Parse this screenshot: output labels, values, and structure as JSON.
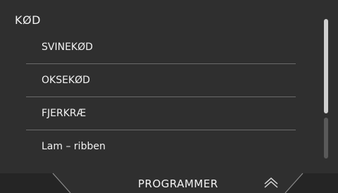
{
  "screen": {
    "title": "KØD"
  },
  "list": {
    "items": [
      {
        "label": "SVINEKØD"
      },
      {
        "label": "OKSEKØD"
      },
      {
        "label": "FJERKRÆ"
      },
      {
        "label": "Lam – ribben"
      }
    ]
  },
  "footer": {
    "label": "PROGRAMMER",
    "up_icon": "double-chevron-up-icon"
  },
  "colors": {
    "background": "#2f2f2f",
    "text": "#f2f2f2",
    "divider": "#6a6a6a",
    "footer_tab": "#252525"
  }
}
